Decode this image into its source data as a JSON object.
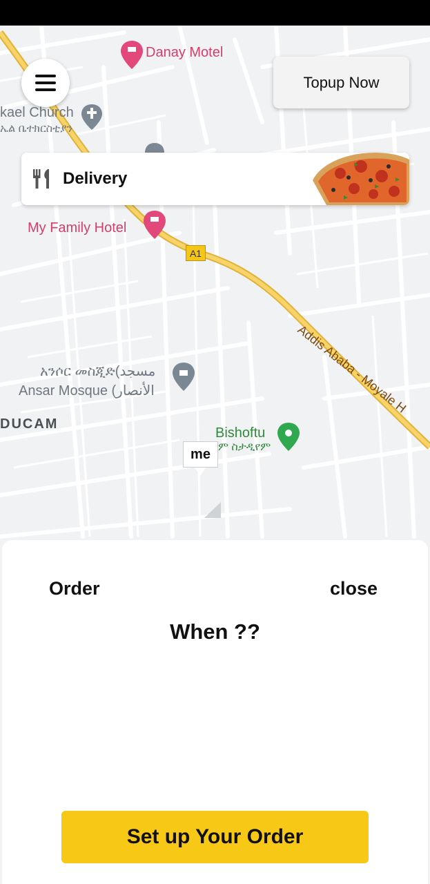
{
  "header": {
    "topup_label": "Topup Now"
  },
  "delivery_card": {
    "label": "Delivery"
  },
  "map": {
    "labels": {
      "danay_motel": "Danay Motel",
      "church_en": "kael Church",
      "church_am": "ኤል ቤተክርስቲያን",
      "family_hotel": "My Family Hotel",
      "road_shield": "A1",
      "highway": "Addis Ababa - Moyale H",
      "mosque_am": "አንሶር መስጂድ(مسجد",
      "mosque_en": "Ansar Mosque (الأنصار",
      "district": "DUCAM",
      "bishoftu_en": "Bishoftu",
      "bishoftu_am": "ም ስታዲየም"
    },
    "me_marker": "me",
    "colors": {
      "road_main": "#f4c84a",
      "road_minor": "#ffffff",
      "background": "#f1f2f4"
    }
  },
  "sheet": {
    "order_label": "Order",
    "close_label": "close",
    "when_label": "When ??",
    "setup_label": "Set up Your Order",
    "accent": "#f7c816"
  }
}
